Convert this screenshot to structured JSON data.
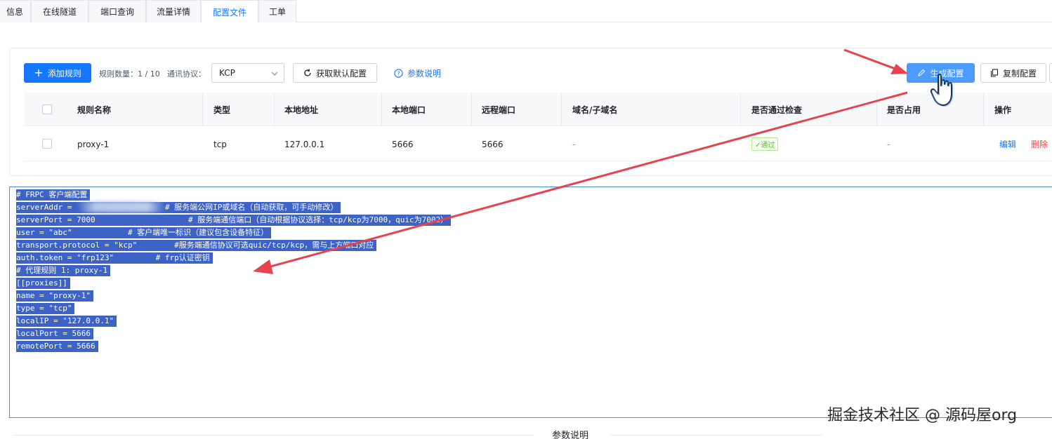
{
  "tabs": [
    {
      "label": "信息"
    },
    {
      "label": "在线隧道"
    },
    {
      "label": "端口查询"
    },
    {
      "label": "流量详情"
    },
    {
      "label": "配置文件",
      "active": true
    },
    {
      "label": "工单"
    }
  ],
  "toolbar": {
    "add_rule_label": "添加规则",
    "rule_count_label": "规则数量：",
    "rule_count_value": "1 / 10",
    "protocol_label": "通讯协议：",
    "protocol_value": "KCP",
    "get_default_label": "获取默认配置",
    "param_help_label": "参数说明",
    "generate_label": "生成配置",
    "copy_label": "复制配置"
  },
  "table": {
    "headers": [
      "规则名称",
      "类型",
      "本地地址",
      "本地端口",
      "远程端口",
      "域名/子域名",
      "是否通过检查",
      "是否占用",
      "操作"
    ],
    "rows": [
      {
        "name": "proxy-1",
        "type": "tcp",
        "local_addr": "127.0.0.1",
        "local_port": "5666",
        "remote_port": "5666",
        "domain": "-",
        "check": "✓通过",
        "occupied": "-",
        "edit": "编辑",
        "delete": "删除"
      }
    ]
  },
  "config_lines": [
    "# FRPC 客户端配置",
    "serverAddr =                    # 服务端公网IP或域名（自动获取，可手动修改）",
    "serverPort = 7000                    # 服务端通信端口（自动根据协议选择：tcp/kcp为7000，quic为7002）",
    "user = \"abc\"            # 客户端唯一标识（建议包含设备特征）",
    "transport.protocol = \"kcp\"        #服务端通信协议可选quic/tcp/kcp，需与上方端口对应",
    "auth.token = \"frp123\"         # frp认证密钥",
    "# 代理规则 1: proxy-1",
    "[[proxies]]",
    "name = \"proxy-1\"",
    "type = \"tcp\"",
    "localIP = \"127.0.0.1\"",
    "localPort = 5666",
    "remotePort = 5666"
  ],
  "footer": {
    "section_title": "参数说明",
    "watermark": "掘金技术社区 @ 源码屋org"
  },
  "colors": {
    "primary": "#1677ff",
    "selection": "#3d63c7",
    "annotation_arrow": "#e8424f",
    "pass_green": "#52c41a",
    "delete_red": "#f53f3f"
  },
  "icons": [
    "plus-icon",
    "chevron-down-icon",
    "refresh-icon",
    "help-circle-icon",
    "pencil-icon",
    "copy-icon",
    "hand-pointer-icon"
  ]
}
